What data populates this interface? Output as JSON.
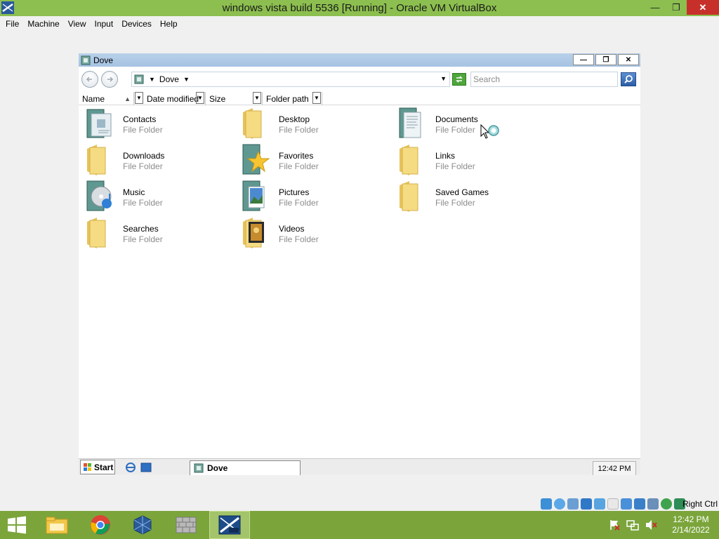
{
  "host": {
    "title": "windows vista build 5536 [Running] - Oracle VM VirtualBox",
    "menu": [
      "File",
      "Machine",
      "View",
      "Input",
      "Devices",
      "Help"
    ],
    "host_key": "Right Ctrl",
    "clock_time": "12:42 PM",
    "clock_date": "2/14/2022",
    "taskbar_apps": [
      "file-explorer-icon",
      "chrome-icon",
      "virtualbox-icon",
      "firewall-icon",
      "vista-icon"
    ]
  },
  "explorer": {
    "window_title": "Dove",
    "address_text": "Dove",
    "search_placeholder": "Search",
    "columns": [
      "Name",
      "Date modified",
      "Size",
      "Folder path"
    ],
    "items": [
      {
        "name": "Contacts",
        "type": "File Folder",
        "icon": "contacts-folder-icon"
      },
      {
        "name": "Desktop",
        "type": "File Folder",
        "icon": "folder-icon"
      },
      {
        "name": "Documents",
        "type": "File Folder",
        "icon": "documents-folder-icon"
      },
      {
        "name": "Downloads",
        "type": "File Folder",
        "icon": "folder-icon"
      },
      {
        "name": "Favorites",
        "type": "File Folder",
        "icon": "favorites-folder-icon"
      },
      {
        "name": "Links",
        "type": "File Folder",
        "icon": "folder-icon"
      },
      {
        "name": "Music",
        "type": "File Folder",
        "icon": "music-folder-icon"
      },
      {
        "name": "Pictures",
        "type": "File Folder",
        "icon": "pictures-folder-icon"
      },
      {
        "name": "Saved Games",
        "type": "File Folder",
        "icon": "folder-icon"
      },
      {
        "name": "Searches",
        "type": "File Folder",
        "icon": "folder-icon"
      },
      {
        "name": "Videos",
        "type": "File Folder",
        "icon": "videos-folder-icon"
      }
    ]
  },
  "guest_taskbar": {
    "start_label": "Start",
    "task_label": "Dove",
    "clock": "12:42 PM"
  },
  "colors": {
    "host_accent": "#8cbf4f",
    "host_taskbar": "#7ba53b",
    "explorer_title": "#b9d1ea",
    "folder_yellow": "#f1d36b"
  }
}
